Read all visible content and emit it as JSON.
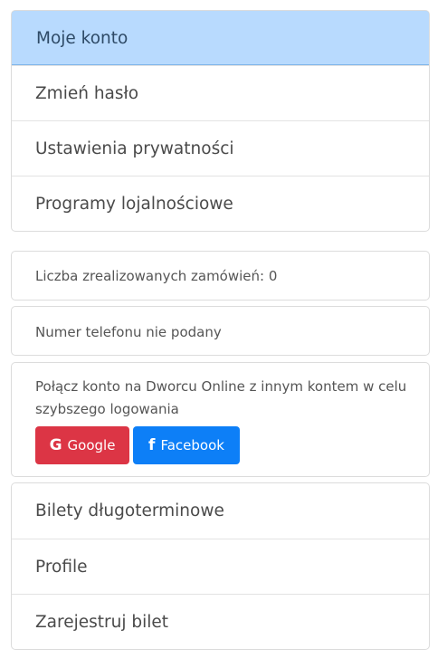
{
  "top_menu": {
    "items": [
      {
        "label": "Moje konto",
        "active": true
      },
      {
        "label": "Zmień hasło"
      },
      {
        "label": "Ustawienia prywatności"
      },
      {
        "label": "Programy lojalnościowe"
      }
    ]
  },
  "info": {
    "orders_text": "Liczba zrealizowanych zamówień: 0",
    "phone_text": "Numer telefonu nie podany"
  },
  "link_accounts": {
    "text": "Połącz konto na Dworcu Online z innym kontem w celu szybszego logowania",
    "google_label": "Google",
    "google_icon": "google-icon",
    "facebook_label": "Facebook",
    "facebook_icon": "facebook-icon"
  },
  "bottom_menu": {
    "items": [
      {
        "label": "Bilety długoterminowe"
      },
      {
        "label": "Profile"
      },
      {
        "label": "Zarejestruj bilet"
      }
    ]
  },
  "colors": {
    "active_bg": "#b8dafe",
    "google": "#dc3545",
    "facebook": "#0d7ff7"
  }
}
